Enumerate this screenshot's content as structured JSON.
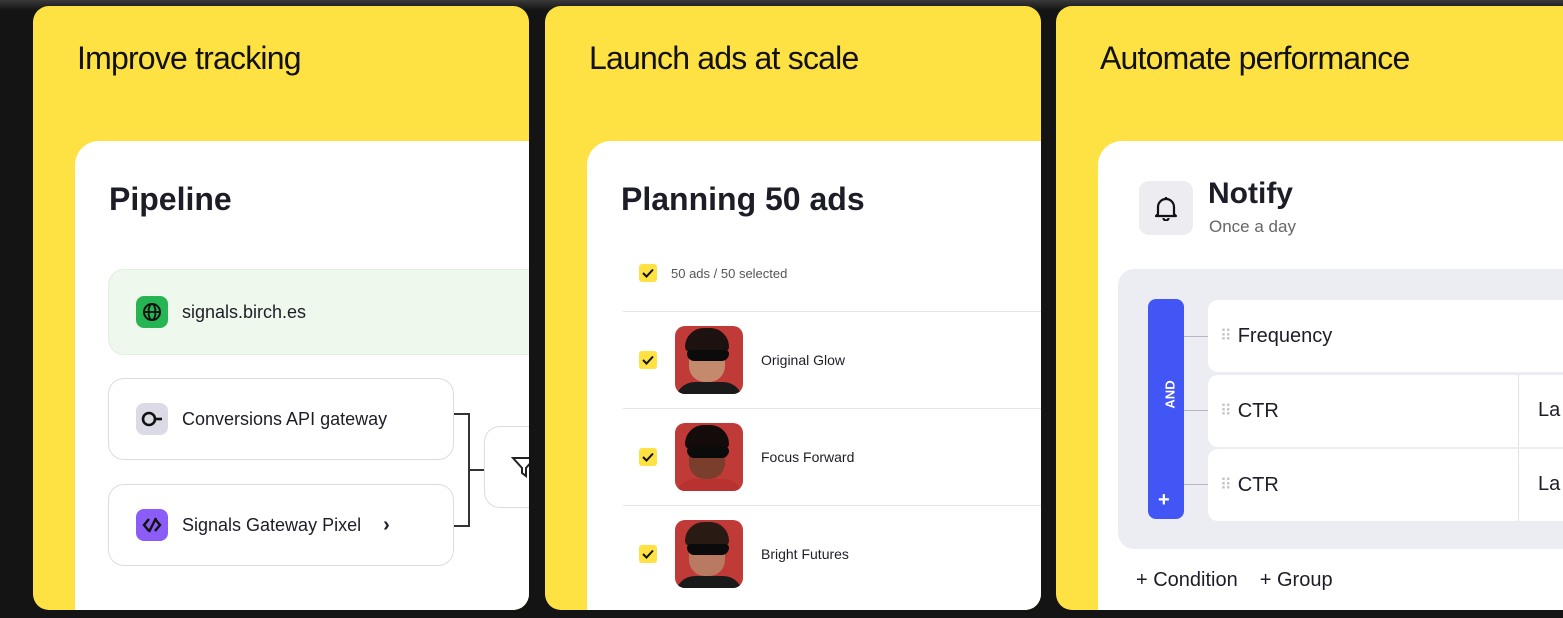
{
  "cards": {
    "tracking": {
      "title": "Improve tracking",
      "panel_title": "Pipeline",
      "domain": "signals.birch.es",
      "nodes": [
        "Conversions API gateway",
        "Signals Gateway Pixel"
      ]
    },
    "ads": {
      "title": "Launch ads at scale",
      "panel_title": "Planning 50 ads",
      "selection": "50 ads / 50 selected",
      "ads": [
        {
          "name": "Original Glow"
        },
        {
          "name": "Focus Forward"
        },
        {
          "name": "Bright Futures"
        }
      ]
    },
    "performance": {
      "title": "Automate performance",
      "panel_title": "Notify",
      "subtitle": "Once a day",
      "group_label": "AND",
      "conditions": [
        {
          "label": "Frequency",
          "extra": ""
        },
        {
          "label": "CTR",
          "extra": "La"
        },
        {
          "label": "CTR",
          "extra": "La"
        }
      ],
      "add_condition": "+ Condition",
      "add_group": "+ Group"
    }
  },
  "colors": {
    "card_yellow": "#fee142",
    "accent_blue": "#4256f5",
    "green": "#26b552",
    "purple": "#8b5cf6"
  }
}
